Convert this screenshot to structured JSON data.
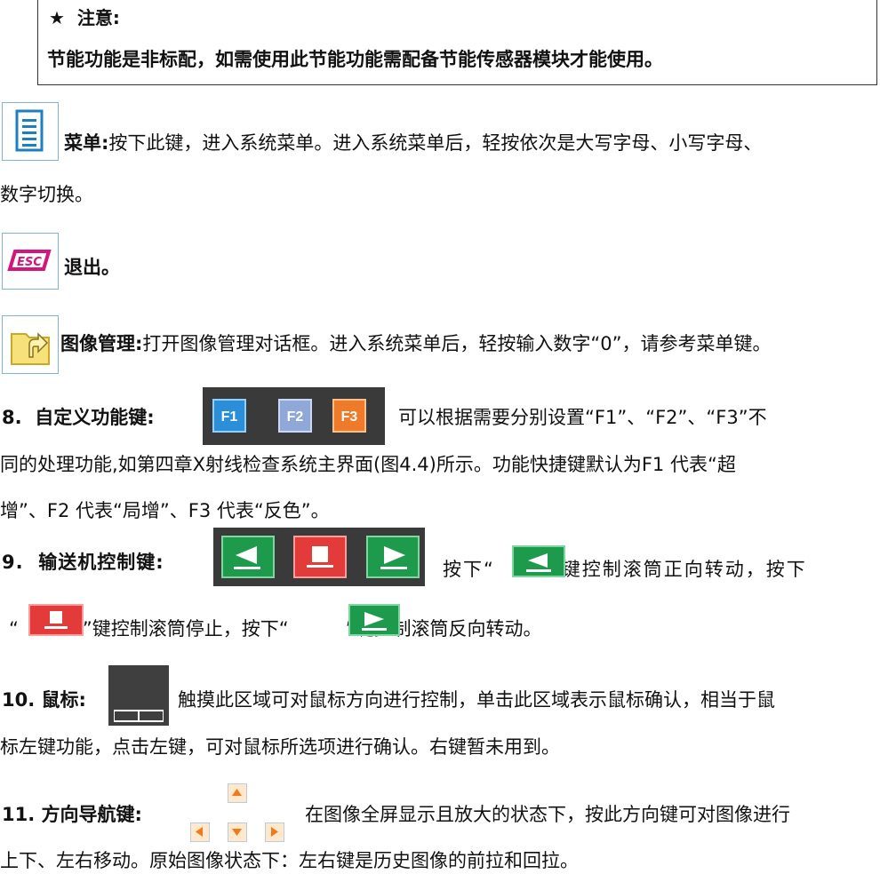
{
  "notice": {
    "star": "★",
    "title": "注意:",
    "text": "节能功能是非标配，如需使用此节能功能需配备节能传感器模块才能使用。"
  },
  "menu": {
    "label": "菜单:",
    "line1": "按下此键，进入系统菜单。进入系统菜单后，轻按依次是大写字母、小写字母、",
    "line2": "数字切换。"
  },
  "esc": {
    "icon_text": "ESC",
    "label": "退出。"
  },
  "image_mgmt": {
    "label": "图像管理:",
    "text": "打开图像管理对话框。进入系统菜单后，轻按输入数字“0”，请参考菜单键。"
  },
  "custom_keys": {
    "number": "8.",
    "label": "自定义功能键:",
    "keys": [
      "F1",
      "F2",
      "F3"
    ],
    "line1": "可以根据需要分别设置“F1”、“F2”、“F3”不",
    "line2": "同的处理功能,如第四章X射线检查系统主界面(图4.4)所示。功能快捷键默认为F1 代表“超",
    "line3": "增”、F2 代表“局增”、F3 代表“反色”。"
  },
  "conveyor": {
    "number": "9.",
    "label": "输送机控制键:",
    "line1_a": "按下“",
    "line1_b": "”键控制滚筒正向转动，按下",
    "line2_a": "“",
    "line2_b": "”键控制滚筒停止，按下“",
    "line2_c": "”键控制滚筒反向转动。"
  },
  "mouse": {
    "number": "10.",
    "label": "鼠标:",
    "line1": "触摸此区域可对鼠标方向进行控制，单击此区域表示鼠标确认，相当于鼠",
    "line2": "标左键功能，点击左键，可对鼠标所选项进行确认。右键暂未用到。"
  },
  "arrows": {
    "number": "11.",
    "label": "方向导航键:",
    "line1": "在图像全屏显示且放大的状态下，按此方向键可对图像进行",
    "line2": "上下、左右移动。原始图像状态下：左右键是历史图像的前拉和回拉。"
  },
  "colors": {
    "esc_magenta": "#d4157a",
    "green_key": "#1e9a4c",
    "red_key": "#e33a3a",
    "menu_blue": "#1b7fc6",
    "arrow_orange": "#ef7a1e"
  }
}
